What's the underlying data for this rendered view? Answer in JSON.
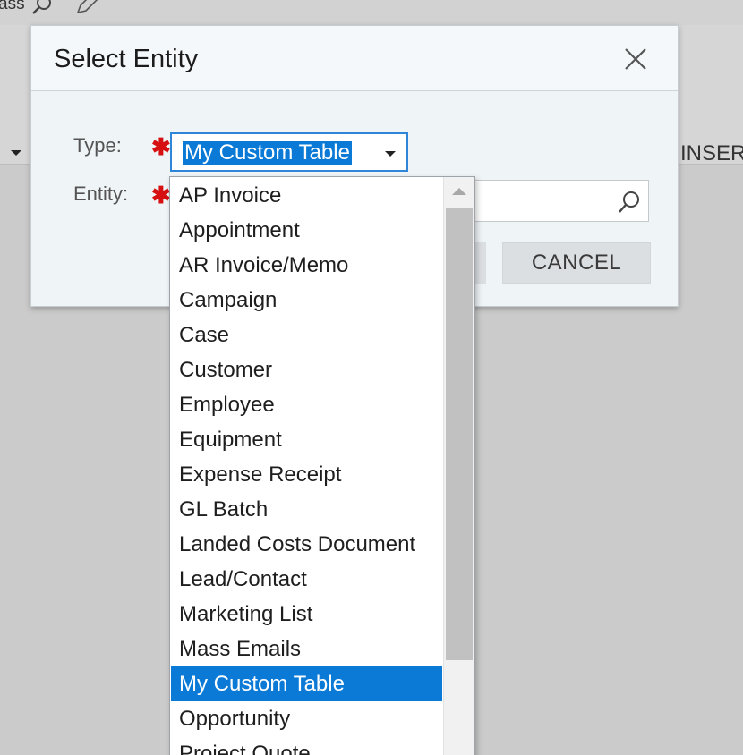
{
  "background": {
    "partial_title": "ass",
    "partial_right_label": "INSERT"
  },
  "dialog": {
    "title": "Select Entity",
    "type_label": "Type:",
    "entity_label": "Entity:",
    "required_mark": "✱",
    "type_value": "My Custom Table",
    "entity_value": "",
    "cancel_label": "CANCEL"
  },
  "dropdown": {
    "items": [
      "AP Invoice",
      "Appointment",
      "AR Invoice/Memo",
      "Campaign",
      "Case",
      "Customer",
      "Employee",
      "Equipment",
      "Expense Receipt",
      "GL Batch",
      "Landed Costs Document",
      "Lead/Contact",
      "Marketing List",
      "Mass Emails",
      "My Custom Table",
      "Opportunity",
      "Project Quote"
    ],
    "selected": "My Custom Table"
  },
  "icons": {
    "search": "search-icon",
    "edit": "pencil-icon",
    "close": "close-icon",
    "caret": "chevron-down-icon",
    "scroll_up": "scroll-up-arrow-icon"
  },
  "colors": {
    "selection": "#0a7ad6",
    "required": "#d61010",
    "focus_border": "#2f86d8"
  }
}
